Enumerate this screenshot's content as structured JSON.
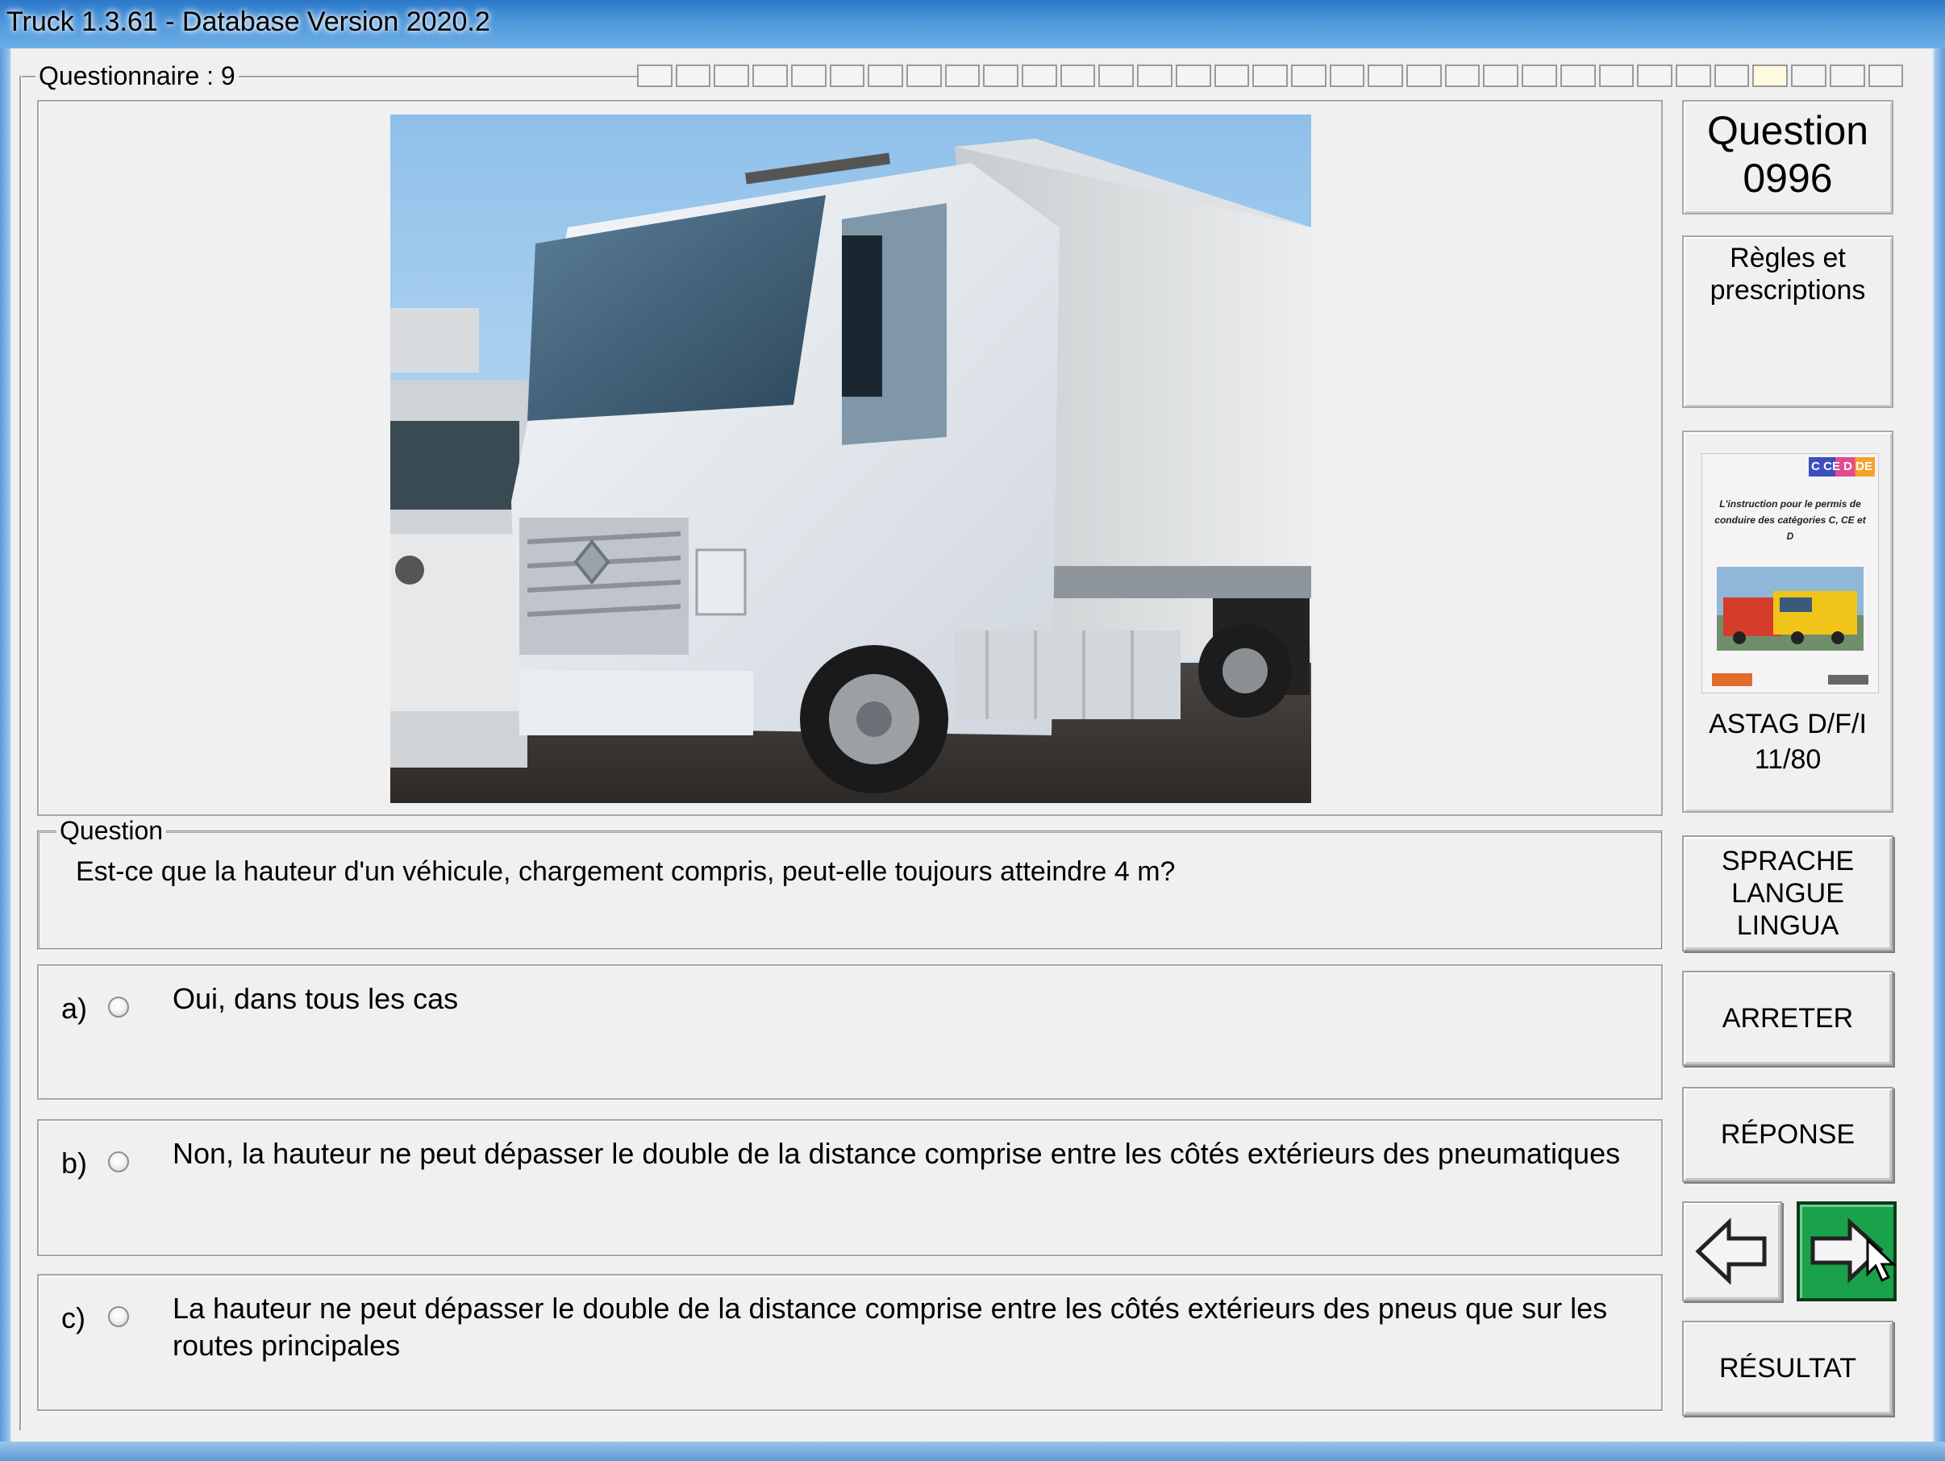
{
  "window": {
    "title": "Truck 1.3.61 - Database Version 2020.2"
  },
  "questionnaire": {
    "legend": "Questionnaire : 9",
    "progress_total": 33,
    "progress_current": 30
  },
  "question": {
    "legend": "Question",
    "text": "Est-ce que la hauteur d'un véhicule, chargement compris, peut-elle toujours atteindre 4 m?"
  },
  "answers": [
    {
      "letter": "a)",
      "text": "Oui, dans tous les cas"
    },
    {
      "letter": "b)",
      "text": "Non, la hauteur ne peut dépasser le double de la distance comprise entre les côtés extérieurs des pneumatiques"
    },
    {
      "letter": "c)",
      "text": "La hauteur ne peut dépasser le double de la distance comprise entre les côtés extérieurs des pneus que sur les routes principales"
    }
  ],
  "sidebar": {
    "question_label": "Question",
    "question_number": "0996",
    "rules_label": "Règles et prescriptions",
    "book_line1": "ASTAG D/F/I",
    "book_line2": "11/80",
    "book_cover_text": "L'instruction pour le permis de conduire des catégories C, CE et D",
    "book_badges": "C CE D DE",
    "language_button": "SPRACHE\nLANGUE\nLINGUA",
    "stop_button": "ARRETER",
    "answer_button": "RÉPONSE",
    "result_button": "RÉSULTAT"
  },
  "colors": {
    "titlebar": "#4f98dc",
    "next_button": "#1aa24a",
    "panel": "#f0f0f0"
  },
  "icons": {
    "prev": "arrow-left-icon",
    "next": "arrow-right-icon",
    "cursor": "mouse-cursor-icon"
  }
}
